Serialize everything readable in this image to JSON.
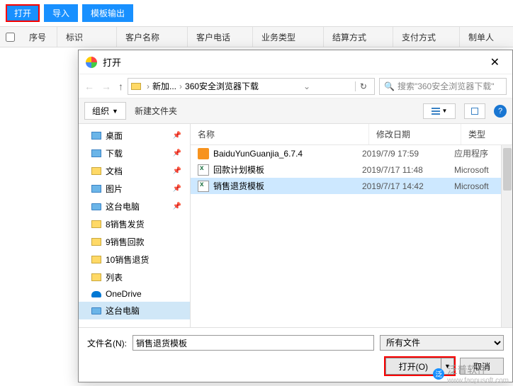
{
  "toolbar": {
    "open": "打开",
    "import": "导入",
    "template_out": "模板输出"
  },
  "headers": {
    "seq": "序号",
    "mark": "标识",
    "customer_name": "客户名称",
    "customer_phone": "客户电话",
    "biz_type": "业务类型",
    "settle_type": "结算方式",
    "pay_type": "支付方式",
    "creator": "制单人"
  },
  "dialog": {
    "title": "打开",
    "breadcrumb": {
      "part1": "新加...",
      "part2": "360安全浏览器下载"
    },
    "search_placeholder": "搜索\"360安全浏览器下载\"",
    "organize": "组织",
    "new_folder": "新建文件夹",
    "columns": {
      "name": "名称",
      "modified": "修改日期",
      "type": "类型"
    },
    "sidebar": [
      {
        "label": "桌面",
        "icon": "blue",
        "pin": true
      },
      {
        "label": "下载",
        "icon": "blue",
        "pin": true
      },
      {
        "label": "文档",
        "icon": "doc",
        "pin": true
      },
      {
        "label": "图片",
        "icon": "blue",
        "pin": true
      },
      {
        "label": "这台电脑",
        "icon": "monitor",
        "pin": true
      },
      {
        "label": "8销售发货",
        "icon": "folder",
        "pin": false
      },
      {
        "label": "9销售回款",
        "icon": "folder",
        "pin": false
      },
      {
        "label": "10销售退货",
        "icon": "folder",
        "pin": false
      },
      {
        "label": "列表",
        "icon": "folder",
        "pin": false
      },
      {
        "label": "OneDrive",
        "icon": "cloud",
        "pin": false
      },
      {
        "label": "这台电脑",
        "icon": "monitor",
        "pin": false,
        "selected": true
      }
    ],
    "files": [
      {
        "name": "BaiduYunGuanjia_6.7.4",
        "date": "2019/7/9 17:59",
        "type": "应用程序",
        "icon": "exe"
      },
      {
        "name": "回款计划模板",
        "date": "2019/7/17 11:48",
        "type": "Microsoft",
        "icon": "excel"
      },
      {
        "name": "销售退货模板",
        "date": "2019/7/17 14:42",
        "type": "Microsoft",
        "icon": "excel",
        "selected": true
      }
    ],
    "filename_label": "文件名(N):",
    "filename_value": "销售退货模板",
    "filter_value": "所有文件",
    "open_btn": "打开(O)",
    "cancel_btn": "取消"
  },
  "watermark": {
    "brand": "泛普软件",
    "url": "www.fanpusoft.com"
  }
}
